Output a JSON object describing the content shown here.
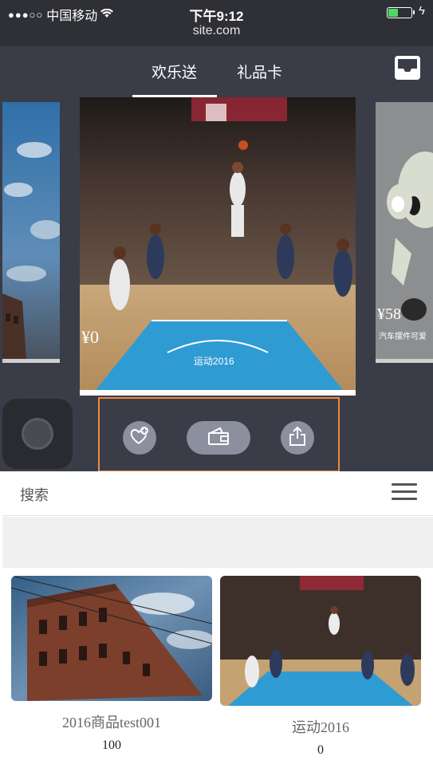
{
  "status": {
    "carrier": "中国移动",
    "signal": "●●●○○",
    "time": "下午9:12",
    "url": "site.com"
  },
  "tabs": [
    {
      "label": "欢乐送",
      "active": true
    },
    {
      "label": "礼品卡",
      "active": false
    }
  ],
  "carousel": {
    "main": {
      "price": "¥0",
      "caption": "运动2016"
    },
    "right": {
      "price": "¥58",
      "caption": "汽车摆件可爱"
    }
  },
  "actions": {
    "like": "heart-plus-icon",
    "wallet": "wallet-icon",
    "share": "share-icon"
  },
  "search": {
    "label": "搜索"
  },
  "products": [
    {
      "title": "2016商品test001",
      "price": "100"
    },
    {
      "title": "运动2016",
      "price": "0"
    }
  ],
  "colors": {
    "dark_bg": "#3a3c48",
    "highlight_border": "#f08a3c",
    "action_button": "#8c8f9e"
  }
}
